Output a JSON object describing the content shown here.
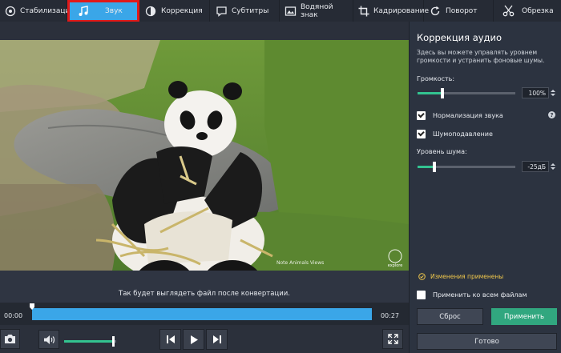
{
  "toolbar": {
    "items": [
      {
        "label": "Стабилизация",
        "icon": "stabilization-icon"
      },
      {
        "label": "Звук",
        "icon": "music-note-icon"
      },
      {
        "label": "Коррекция",
        "icon": "color-correction-icon"
      },
      {
        "label": "Субтитры",
        "icon": "subtitles-icon"
      },
      {
        "label": "Водяной знак",
        "icon": "watermark-icon"
      },
      {
        "label": "Кадрирование",
        "icon": "crop-icon"
      },
      {
        "label": "Поворот",
        "icon": "rotate-icon"
      },
      {
        "label": "Обрезка",
        "icon": "scissors-icon"
      }
    ],
    "active_index": 1
  },
  "video": {
    "watermark_text": "Note Animals Views",
    "logo_text": "explore",
    "caption": "Так будет выглядеть файл после конвертации."
  },
  "timeline": {
    "start_time": "00:00",
    "end_time": "00:27"
  },
  "controls": {
    "volume_level": 0.95
  },
  "panel": {
    "title": "Коррекция аудио",
    "description": "Здесь вы можете управлять уровнем громкости и устранить фоновые шумы.",
    "volume_label": "Громкость:",
    "volume_value": "100%",
    "volume_level": 0.25,
    "normalize_label": "Нормализация звука",
    "normalize_checked": true,
    "help_symbol": "?",
    "denoise_label": "Шумоподавление",
    "denoise_checked": true,
    "noise_level_label": "Уровень шума:",
    "noise_value": "-25дБ",
    "noise_level": 0.17,
    "applied_text": "Изменения применены",
    "apply_all_label": "Применить ко всем файлам",
    "apply_all_checked": false,
    "reset_label": "Сброс",
    "apply_label": "Применить",
    "done_label": "Готово"
  },
  "colors": {
    "accent": "#3aa6e8",
    "green": "#33c390",
    "highlight": "#e01919",
    "applied": "#f2c94c"
  }
}
